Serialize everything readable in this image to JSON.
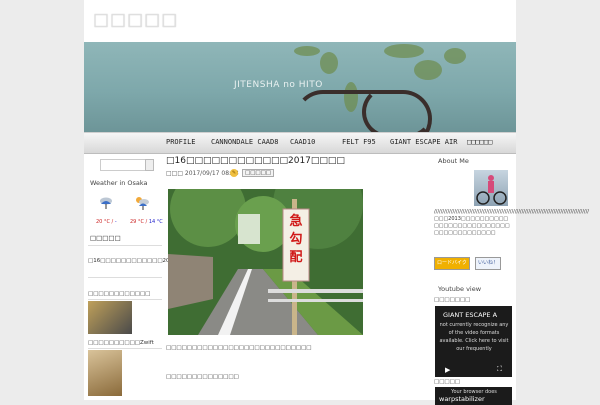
{
  "site": {
    "title": "□□□□□",
    "banner_caption": "JITENSHA no HITO"
  },
  "nav": {
    "items": [
      "PROFILE",
      "CANNONDALE CAAD8",
      "CAAD10",
      "FELT F95",
      "GIANT ESCAPE AIR",
      "□□□□□□"
    ]
  },
  "left_sidebar": {
    "weather_title": "Weather in Osaka",
    "temp1": {
      "hi": "20 °C",
      "lo": "- "
    },
    "temp2": {
      "hi": "29 °C",
      "lo": "14 °C"
    },
    "heading1": "□□□□□",
    "link1": "□16□□□□□□□□□□□□2017□□□□",
    "link2": "□□□□□□□□□□□□",
    "link3": "□□□□□□□□□□Zwift"
  },
  "post": {
    "title": "□16□□□□□□□□□□□□2017□□□□",
    "date": "□□□ 2017/09/17 08:23",
    "category": "□□□□□",
    "sign_text": "急勾配",
    "line1": "□□□□□□□□□□□□□□□□□□□□□□□□□□□□",
    "line2": "□□□□□□□□□□□□□□"
  },
  "right_sidebar": {
    "about_title": "About Me",
    "slashes": "////////////////////////////////////////////////////////////////////////////////////////////",
    "about_text": "□□□2013□□□□□□□□□□□□□□□□□□□□□□□□□□□□□□□□□□□□□□□",
    "badge_label": "ロードバイク",
    "like_label": "いいね！",
    "youtube_title": "Youtube view",
    "video1_heading": "□□□□□□□",
    "video1_title": "GIANT ESCAPE A",
    "video1_msg": "not currently recognize any of the video formats available. Click here to visit our frequently",
    "video2_heading": "□□□□□",
    "video2_msg": "Your browser does",
    "video2_title": "warpstabilizer"
  },
  "colors": {
    "accent": "#cc0000",
    "badge": "#f0b000"
  }
}
